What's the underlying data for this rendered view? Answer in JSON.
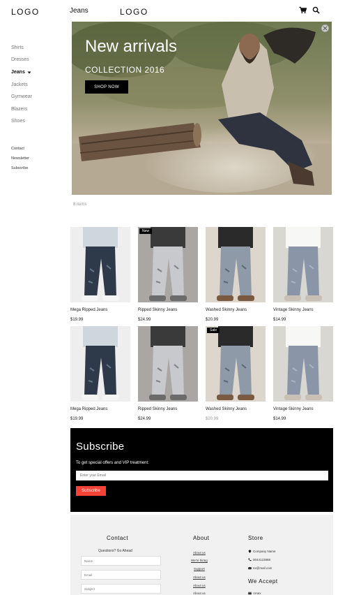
{
  "header": {
    "logo_left": "LOGO",
    "page_title": "Jeans",
    "logo_center": "LOGO",
    "icons": [
      "cart-icon",
      "search-icon"
    ]
  },
  "sidebar": {
    "categories": [
      {
        "label": "Shirts",
        "active": false
      },
      {
        "label": "Dresses",
        "active": false
      },
      {
        "label": "Jeans",
        "active": true
      },
      {
        "label": "Jackets",
        "active": false
      },
      {
        "label": "Gymwear",
        "active": false
      },
      {
        "label": "Blazers",
        "active": false
      },
      {
        "label": "Shoes",
        "active": false
      }
    ],
    "links": [
      "Contact",
      "Newsletter",
      "Subscribe"
    ]
  },
  "hero": {
    "title": "New arrivals",
    "subtitle": "COLLECTION 2016",
    "button": "SHOP NOW"
  },
  "items_count": "8 items",
  "products": [
    {
      "name": "Mega Ripped Jeans",
      "price": "$19.99",
      "badge": "",
      "sale": false,
      "image": "dark-ripped-jeans"
    },
    {
      "name": "Ripped Skinny Jeans",
      "price": "$24.99",
      "badge": "New",
      "sale": false,
      "image": "light-ripped-jeans"
    },
    {
      "name": "Washed Skinny Jeans",
      "price": "$20.99",
      "badge": "",
      "sale": false,
      "image": "washed-jeans"
    },
    {
      "name": "Vintage Skinny Jeans",
      "price": "$14.99",
      "badge": "",
      "sale": false,
      "image": "vintage-jeans"
    },
    {
      "name": "Mega Ripped Jeans",
      "price": "$19.99",
      "badge": "",
      "sale": false,
      "image": "dark-ripped-jeans"
    },
    {
      "name": "Ripped Skinny Jeans",
      "price": "$24.99",
      "badge": "",
      "sale": false,
      "image": "light-ripped-jeans"
    },
    {
      "name": "Washed Skinny Jeans",
      "price": "$20.99",
      "badge": "Sale",
      "sale": true,
      "image": "washed-jeans"
    },
    {
      "name": "Vintage Skinny Jeans",
      "price": "$14.99",
      "badge": "",
      "sale": false,
      "image": "vintage-jeans"
    }
  ],
  "subscribe": {
    "title": "Subscribe",
    "text": "To get special offers and VIP treatment:",
    "placeholder": "Enter your Email",
    "button": "Subscribe",
    "button_color": "#f44336"
  },
  "footer": {
    "contact_title": "Contact",
    "contact_sub": "Questions? Go Ahead",
    "contact_fields": [
      "Name",
      "Email",
      "Subject"
    ],
    "about_title": "About",
    "about_links": [
      "About us",
      "We're hiring",
      "Support",
      "About us",
      "About us",
      "About us"
    ],
    "store_title": "Store",
    "store_rows": [
      {
        "icon": "map-marker-icon",
        "text": "Company Name"
      },
      {
        "icon": "phone-icon",
        "text": "0044123888"
      },
      {
        "icon": "envelope-icon",
        "text": "ex@mail.com"
      }
    ],
    "accept_title": "We Accept",
    "accept_item": "Amex"
  }
}
